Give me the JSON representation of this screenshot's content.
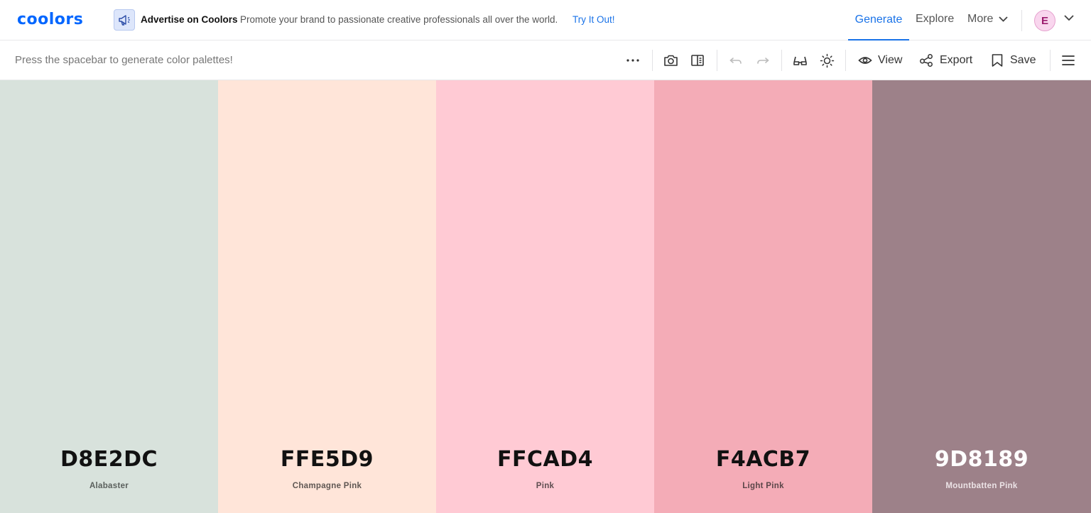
{
  "nav": {
    "logo": "coolors",
    "ad_icon": "megaphone-icon",
    "ad_title": "Advertise on Coolors",
    "ad_text": "Promote your brand to passionate creative professionals all over the world.",
    "ad_link": "Try It Out!",
    "generate": "Generate",
    "explore": "Explore",
    "more": "More",
    "avatar_initial": "E",
    "accent_color": "#1a73e8"
  },
  "toolbar": {
    "hint": "Press the spacebar to generate color palettes!",
    "view": "View",
    "export": "Export",
    "save": "Save",
    "icons": [
      "more-dots-icon",
      "camera-icon",
      "side-panel-icon",
      "undo-icon",
      "redo-icon",
      "glasses-icon",
      "sun-icon",
      "eye-icon",
      "share-icon",
      "bookmark-icon",
      "menu-icon"
    ]
  },
  "palette": [
    {
      "hex": "D8E2DC",
      "name": "Alabaster",
      "color": "#D8E2DC",
      "text_color": "#111111",
      "sub_color": "#5a5f5c"
    },
    {
      "hex": "FFE5D9",
      "name": "Champagne Pink",
      "color": "#FFE5D9",
      "text_color": "#111111",
      "sub_color": "#5f5753"
    },
    {
      "hex": "FFCAD4",
      "name": "Pink",
      "color": "#FFCAD4",
      "text_color": "#111111",
      "sub_color": "#5f4e51"
    },
    {
      "hex": "F4ACB7",
      "name": "Light Pink",
      "color": "#F4ACB7",
      "text_color": "#111111",
      "sub_color": "#5b4649"
    },
    {
      "hex": "9D8189",
      "name": "Mountbatten Pink",
      "color": "#9D8189",
      "text_color": "#ffffff",
      "sub_color": "#ece3e6"
    }
  ]
}
